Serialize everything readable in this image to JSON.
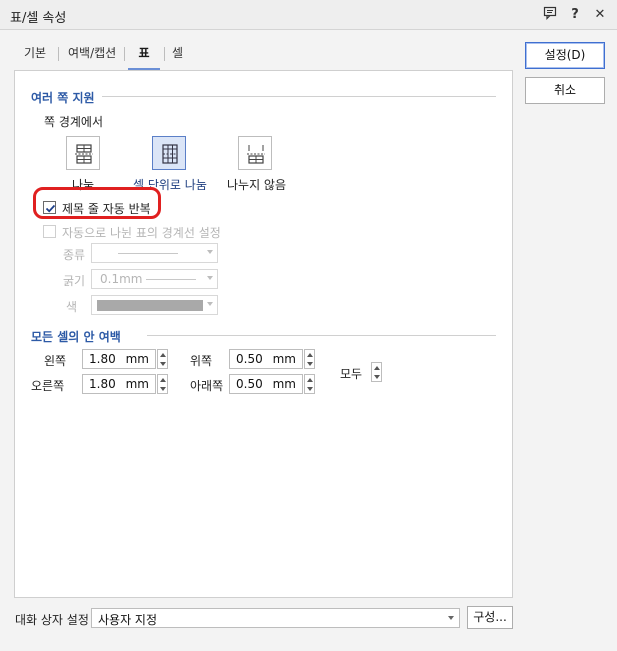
{
  "window": {
    "title": "표/셀 속성",
    "help_label": "?",
    "close_label": "✕"
  },
  "tabs": [
    {
      "label": "기본",
      "active": false
    },
    {
      "label": "여백/캡션",
      "active": false
    },
    {
      "label": "표",
      "active": true
    },
    {
      "label": "셀",
      "active": false
    }
  ],
  "buttons": {
    "ok": "설정(D)",
    "cancel": "취소",
    "configure": "구성..."
  },
  "multi_page": {
    "section_title": "여러 쪽 지원",
    "page_border_label": "쪽 경계에서",
    "options": [
      {
        "label": "나눔",
        "icon": "table-split-icon",
        "selected": false
      },
      {
        "label": "셀 단위로 나눔",
        "icon": "table-split-cell-icon",
        "selected": true
      },
      {
        "label": "나누지 않음",
        "icon": "table-nosplit-icon",
        "selected": false
      }
    ],
    "repeat_title_label": "제목 줄 자동 반복",
    "repeat_title_checked": true,
    "auto_border_label": "자동으로 나뉜 표의 경계선 설정",
    "auto_border_checked": false,
    "type_label": "종류",
    "thickness_label": "굵기",
    "thickness_value": "0.1mm",
    "color_label": "색"
  },
  "cell_margin": {
    "section_title": "모든 셀의 안 여백",
    "left_label": "왼쪽",
    "left_value": "1.80",
    "right_label": "오른쪽",
    "right_value": "1.80",
    "top_label": "위쪽",
    "top_value": "0.50",
    "bottom_label": "아래쪽",
    "bottom_value": "0.50",
    "unit": "mm",
    "all_label": "모두"
  },
  "dialog_settings": {
    "label": "대화 상자 설정",
    "value": "사용자 지정"
  },
  "colors": {
    "accent": "#2d5aa6",
    "highlight": "#e02020"
  }
}
